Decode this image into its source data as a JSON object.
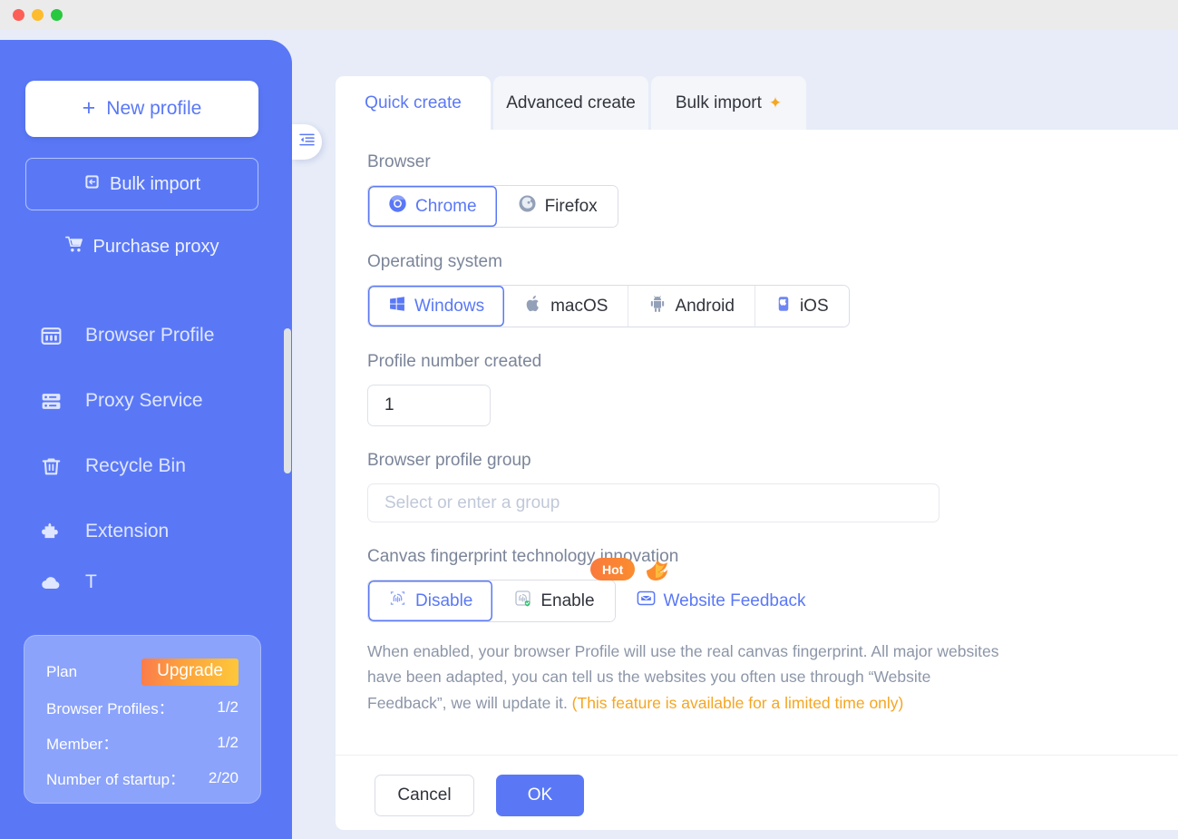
{
  "window": {
    "traffic_lights": [
      "close",
      "minimize",
      "maximize"
    ]
  },
  "sidebar": {
    "new_profile_label": "New profile",
    "new_profile_icon": "plus-icon",
    "bulk_import_label": "Bulk import",
    "bulk_import_icon": "import-box-icon",
    "purchase_proxy_label": "Purchase proxy",
    "purchase_proxy_icon": "shopping-cart-icon",
    "items": [
      {
        "label": "Browser Profile",
        "icon": "browser-window-icon"
      },
      {
        "label": "Proxy Service",
        "icon": "server-stack-icon"
      },
      {
        "label": "Recycle Bin",
        "icon": "trash-bin-icon"
      },
      {
        "label": "Extension",
        "icon": "puzzle-piece-icon"
      }
    ],
    "plan_card": {
      "title": "Plan",
      "upgrade_label": "Upgrade",
      "rows": [
        {
          "label": "Browser Profiles：",
          "value": "1/2"
        },
        {
          "label": "Member：",
          "value": "1/2"
        },
        {
          "label": "Number of startup：",
          "value": "2/20"
        }
      ]
    },
    "collapse_icon": "indent-left-icon",
    "accent_color": "#5a78f6"
  },
  "main": {
    "tabs": [
      {
        "label": "Quick create",
        "active": true,
        "badge": ""
      },
      {
        "label": "Advanced create",
        "active": false,
        "badge": ""
      },
      {
        "label": "Bulk import",
        "active": false,
        "badge": "✦"
      }
    ],
    "browser": {
      "label": "Browser",
      "options": [
        {
          "label": "Chrome",
          "icon": "chrome-icon",
          "selected": true
        },
        {
          "label": "Firefox",
          "icon": "firefox-icon",
          "selected": false
        }
      ]
    },
    "operating_system": {
      "label": "Operating system",
      "options": [
        {
          "label": "Windows",
          "icon": "windows-icon",
          "selected": true
        },
        {
          "label": "macOS",
          "icon": "apple-icon",
          "selected": false
        },
        {
          "label": "Android",
          "icon": "android-icon",
          "selected": false
        },
        {
          "label": "iOS",
          "icon": "iphone-icon",
          "selected": false
        }
      ]
    },
    "profile_number": {
      "label": "Profile number created",
      "value": "1"
    },
    "profile_group": {
      "label": "Browser profile group",
      "value": "",
      "placeholder": "Select or enter a group"
    },
    "canvas": {
      "label": "Canvas fingerprint technology innovation",
      "options": [
        {
          "label": "Disable",
          "icon": "fingerprint-off-icon",
          "selected": true
        },
        {
          "label": "Enable",
          "icon": "fingerprint-shield-icon",
          "selected": false
        }
      ],
      "hot_badge": "Hot",
      "feedback_label": "Website Feedback",
      "feedback_icon": "mail-feedback-icon",
      "description_line1": "When enabled, your browser Profile will use the real canvas fingerprint. All major",
      "description_line2": "websites have been adapted, you can tell us the websites you often use through",
      "description_line3": "“Website Feedback”, we will update it. ",
      "description_highlight": "(This feature is available for a limited time only)"
    },
    "footer": {
      "cancel_label": "Cancel",
      "ok_label": "OK"
    }
  },
  "colors": {
    "accent": "#5a78f6",
    "canvas_bg": "#e7ecf8",
    "hot_orange": "#f97a3d",
    "highlight_yellow": "#f5a623"
  }
}
